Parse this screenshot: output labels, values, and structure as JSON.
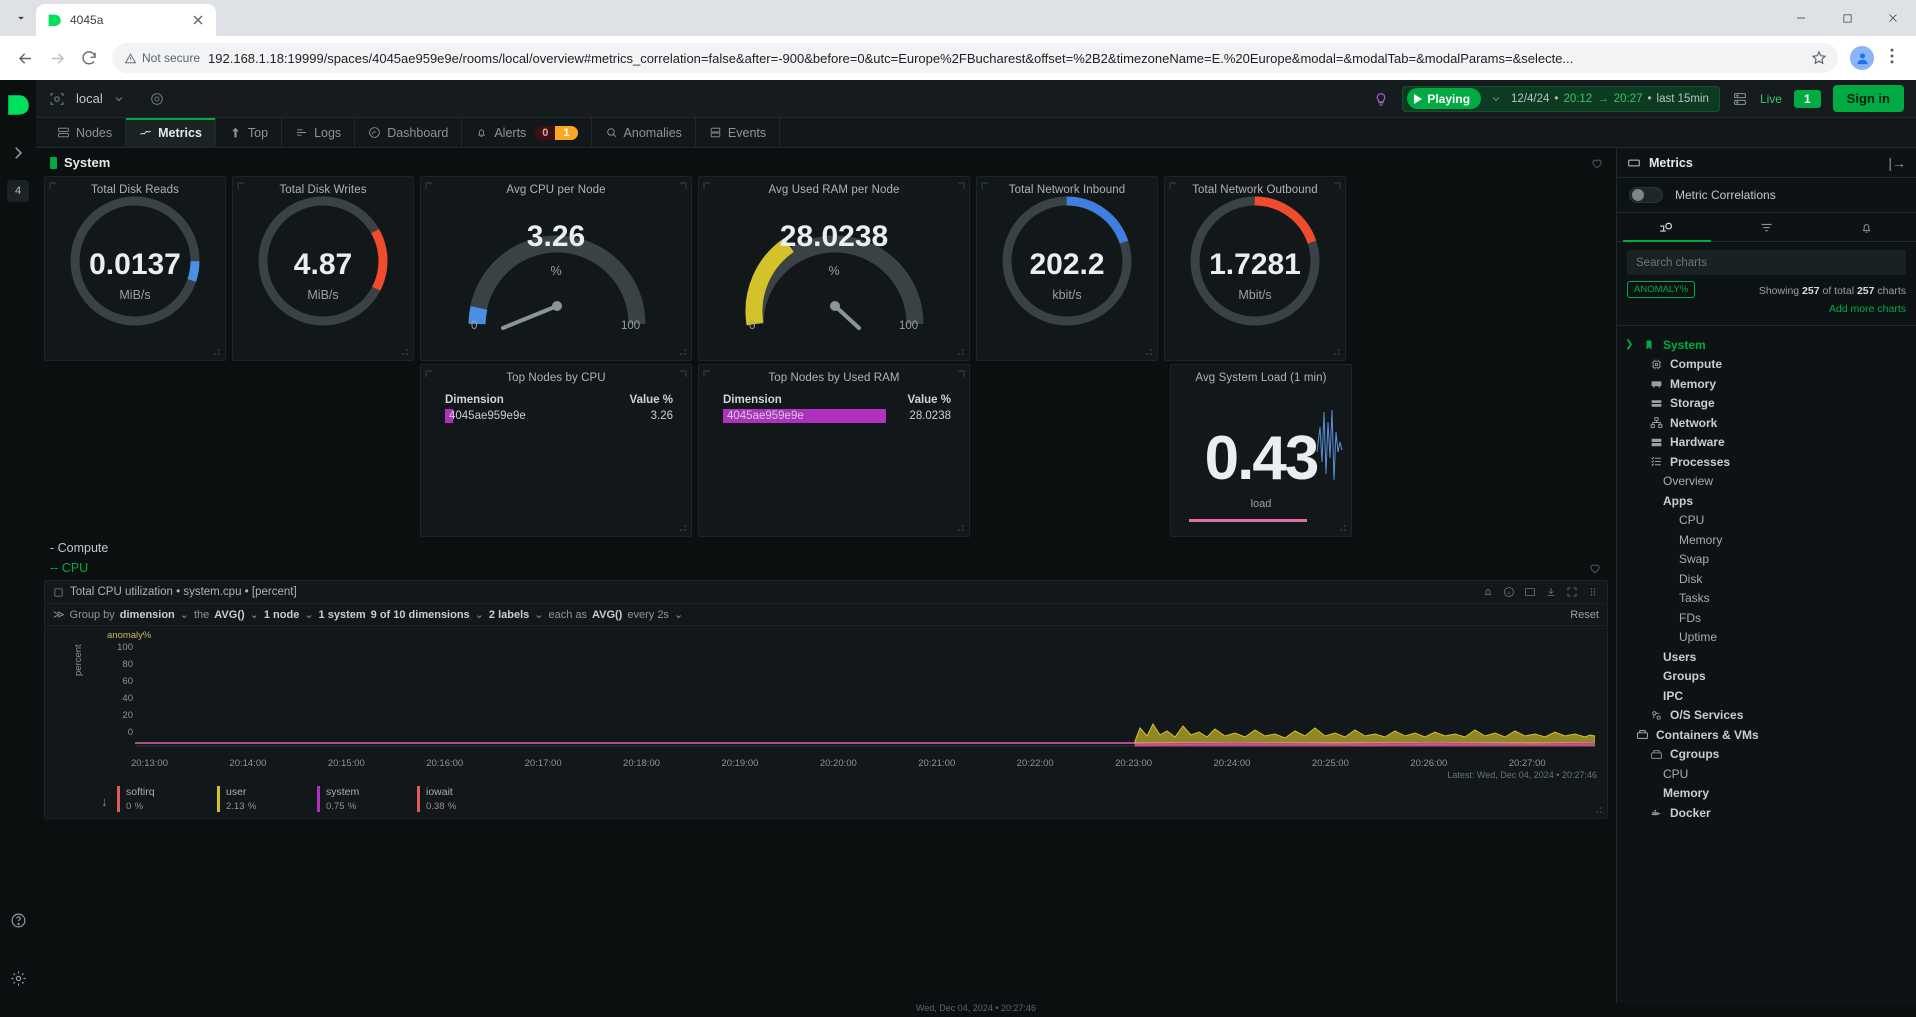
{
  "browser": {
    "tab": {
      "title": "4045a",
      "favicon": "netdata-logo-icon",
      "close": "close-icon"
    },
    "url": "192.168.1.18:19999/spaces/4045ae959e9e/rooms/local/overview#metrics_correlation=false&after=-900&before=0&utc=Europe%2FBucharest&offset=%2B2&timezoneName=E.%20Europe&modal=&modalTab=&modalParams=&selecte...",
    "security_label": "Not secure",
    "back": "back-icon",
    "forward": "forward-icon",
    "reload": "reload-icon",
    "bookmark": "star-icon",
    "menu": "kebab-menu-icon",
    "minimize": "minimize-icon",
    "maximize": "maximize-icon",
    "window_close": "window-close-icon",
    "tab_list": "tab-search-icon"
  },
  "header": {
    "space_name": "local",
    "space_icon": "room-icon",
    "settings_icon": "gear-icon",
    "bulb_icon": "bulb-icon",
    "playing_label": "Playing",
    "date": "12/4/24",
    "time_from": "20:12",
    "time_to": "20:27",
    "range_suffix": "last  15min",
    "nodes_icon": "nodes-icon",
    "live_label": "Live",
    "live_count": "1",
    "signin_label": "Sign in"
  },
  "nav_tabs": [
    {
      "label": "Nodes",
      "icon": "nodes-icon",
      "active": false
    },
    {
      "label": "Metrics",
      "icon": "metrics-icon",
      "active": true
    },
    {
      "label": "Top",
      "icon": "top-arrow-icon",
      "active": false
    },
    {
      "label": "Logs",
      "icon": "logs-icon",
      "active": false
    },
    {
      "label": "Dashboard",
      "icon": "dashboard-icon",
      "active": false
    },
    {
      "label": "Alerts",
      "icon": "bell-icon",
      "active": false,
      "critical": "0",
      "warning": "1"
    },
    {
      "label": "Anomalies",
      "icon": "anomalies-search-icon",
      "active": false
    },
    {
      "label": "Events",
      "icon": "events-icon",
      "active": false
    }
  ],
  "rail": {
    "logo": "netdata-logo-icon",
    "expand_icon": "chevron-right-icon",
    "badge": "4",
    "help_icon": "help-circle-icon",
    "settings_icon": "gear-icon"
  },
  "sections": {
    "system": "System",
    "compute": "Compute",
    "cpu": "CPU"
  },
  "gauges": [
    {
      "title": "Total Disk Reads",
      "value": "0.0137",
      "unit": "MiB/s",
      "type": "ring",
      "color": "#4a90e2",
      "pct": 0.05,
      "start": 0.3
    },
    {
      "title": "Total Disk Writes",
      "value": "4.87",
      "unit": "MiB/s",
      "type": "ring",
      "color": "#ef4b2c",
      "pct": 0.17,
      "start": 0.22
    },
    {
      "title": "Avg CPU per Node",
      "value": "3.26",
      "unit": "%",
      "type": "needle",
      "color": "#4a90e2",
      "min": "0",
      "max": "100",
      "pct": 0.0326
    },
    {
      "title": "Avg Used RAM per Node",
      "value": "28.0238",
      "unit": "%",
      "type": "needle",
      "color": "#d4c22b",
      "min": "0",
      "max": "100",
      "pct": 0.28
    },
    {
      "title": "Total Network Inbound",
      "value": "202.2",
      "unit": "kbit/s",
      "type": "ring",
      "color": "#3f7fe0",
      "pct": 0.2,
      "start": 0.0
    },
    {
      "title": "Total Network Outbound",
      "value": "1.7281",
      "unit": "Mbit/s",
      "type": "ring",
      "color": "#ef4b2c",
      "pct": 0.2,
      "start": 0.0
    }
  ],
  "top_tables": [
    {
      "title": "Top Nodes by CPU",
      "col_dimension": "Dimension",
      "col_value": "Value %",
      "rows": [
        {
          "name": "4045ae959e9e",
          "value": "3.26",
          "bar_pct": 3.26,
          "color": "#b030c0"
        }
      ]
    },
    {
      "title": "Top Nodes by Used RAM",
      "col_dimension": "Dimension",
      "col_value": "Value %",
      "rows": [
        {
          "name": "4045ae959e9e",
          "value": "28.0238",
          "bar_pct": 28.02,
          "color": "#b030c0"
        }
      ]
    }
  ],
  "load_card": {
    "title": "Avg System Load (1 min)",
    "value": "0.43",
    "unit": "load"
  },
  "big_chart": {
    "title": "Total CPU utilization • system.cpu • [percent]",
    "toolbar_icons": [
      "alert-bell-icon",
      "info-icon",
      "chart-type-icon",
      "download-icon",
      "fullscreen-icon",
      "drag-icon"
    ],
    "groupby_prefix": "Group by",
    "groupby_value": "dimension",
    "agg_prefix": "the",
    "agg_value": "AVG()",
    "node_count": "1 node",
    "system_count": "1 system",
    "dimension_count": "9 of 10 dimensions",
    "label_count": "2 labels",
    "each_as_prefix": "each as",
    "each_as_value": "AVG()",
    "every_text": "every 2s",
    "reset_label": "Reset",
    "anomaly_label": "anomaly%",
    "ylabel": "percent",
    "latest_note": "Latest: Wed, Dec 04, 2024 • 20:27:46",
    "legend": [
      {
        "name": "softirq",
        "value": "0",
        "unit": "%",
        "color": "#e05c5c"
      },
      {
        "name": "user",
        "value": "2.13",
        "unit": "%",
        "color": "#d4c22b"
      },
      {
        "name": "system",
        "value": "0.75",
        "unit": "%",
        "color": "#b030c0"
      },
      {
        "name": "iowait",
        "value": "0.38",
        "unit": "%",
        "color": "#e05c5c"
      }
    ]
  },
  "chart_data": {
    "type": "area",
    "title": "Total CPU utilization • system.cpu • [percent]",
    "xlabel": "",
    "ylabel": "percent",
    "ylim": [
      0,
      100
    ],
    "yticks": [
      "100",
      "80",
      "60",
      "40",
      "20",
      "0"
    ],
    "xticks": [
      "20:13:00",
      "20:14:00",
      "20:15:00",
      "20:16:00",
      "20:17:00",
      "20:18:00",
      "20:19:00",
      "20:20:00",
      "20:21:00",
      "20:22:00",
      "20:23:00",
      "20:24:00",
      "20:25:00",
      "20:26:00",
      "20:27:00"
    ],
    "grid": false,
    "legend_position": "bottom",
    "series": [
      {
        "name": "softirq",
        "color": "#e05c5c",
        "latest": 0
      },
      {
        "name": "user",
        "color": "#d4c22b",
        "latest": 2.13
      },
      {
        "name": "system",
        "color": "#b030c0",
        "latest": 0.75
      },
      {
        "name": "iowait",
        "color": "#e05c5c",
        "latest": 0.38
      }
    ],
    "note": "Data present only from ~20:24:00 onward; flat near 3% with small spikes to ~8%"
  },
  "right_panel": {
    "title": "Metrics",
    "panel_icon": "panel-icon",
    "collapse_icon": "collapse-right-icon",
    "toggle_label": "Metric Correlations",
    "tabs": [
      {
        "icon": "charts-tree-icon",
        "active": true
      },
      {
        "icon": "filter-icon",
        "active": false
      },
      {
        "icon": "bell-icon",
        "active": false
      }
    ],
    "search_placeholder": "Search charts",
    "anomaly_chip": "ANOMALY%",
    "showing_prefix": "Showing",
    "showing_count": "257",
    "showing_mid": "of total",
    "total_count": "257",
    "showing_suffix": "charts",
    "add_more": "Add more charts",
    "tree": [
      {
        "label": "System",
        "level": "root",
        "icon": "bookmark-icon",
        "caret": "›"
      },
      {
        "label": "Compute",
        "level": "leaf",
        "icon": "cpu-chip-icon"
      },
      {
        "label": "Memory",
        "level": "leaf",
        "icon": "memory-icon"
      },
      {
        "label": "Storage",
        "level": "leaf",
        "icon": "storage-icon"
      },
      {
        "label": "Network",
        "level": "leaf",
        "icon": "network-icon"
      },
      {
        "label": "Hardware",
        "level": "leaf",
        "icon": "hardware-icon"
      },
      {
        "label": "Processes",
        "level": "leaf",
        "icon": "processes-icon"
      },
      {
        "label": "Overview",
        "level": "sub"
      },
      {
        "label": "Apps",
        "level": "group"
      },
      {
        "label": "CPU",
        "level": "sub2"
      },
      {
        "label": "Memory",
        "level": "sub2"
      },
      {
        "label": "Swap",
        "level": "sub2"
      },
      {
        "label": "Disk",
        "level": "sub2"
      },
      {
        "label": "Tasks",
        "level": "sub2"
      },
      {
        "label": "FDs",
        "level": "sub2"
      },
      {
        "label": "Uptime",
        "level": "sub2"
      },
      {
        "label": "Users",
        "level": "group"
      },
      {
        "label": "Groups",
        "level": "group"
      },
      {
        "label": "IPC",
        "level": "group"
      },
      {
        "label": "O/S Services",
        "level": "leafbold",
        "icon": "services-icon"
      },
      {
        "label": "Containers & VMs",
        "level": "rootdark",
        "icon": "containers-icon"
      },
      {
        "label": "Cgroups",
        "level": "leafbold",
        "icon": "cgroups-icon"
      },
      {
        "label": "CPU",
        "level": "sub"
      },
      {
        "label": "Memory",
        "level": "sub"
      },
      {
        "label": "Docker",
        "level": "leafbold",
        "icon": "docker-icon"
      }
    ]
  },
  "statusbar": {
    "text": "Wed, Dec 04, 2024 • 20:27:46"
  }
}
